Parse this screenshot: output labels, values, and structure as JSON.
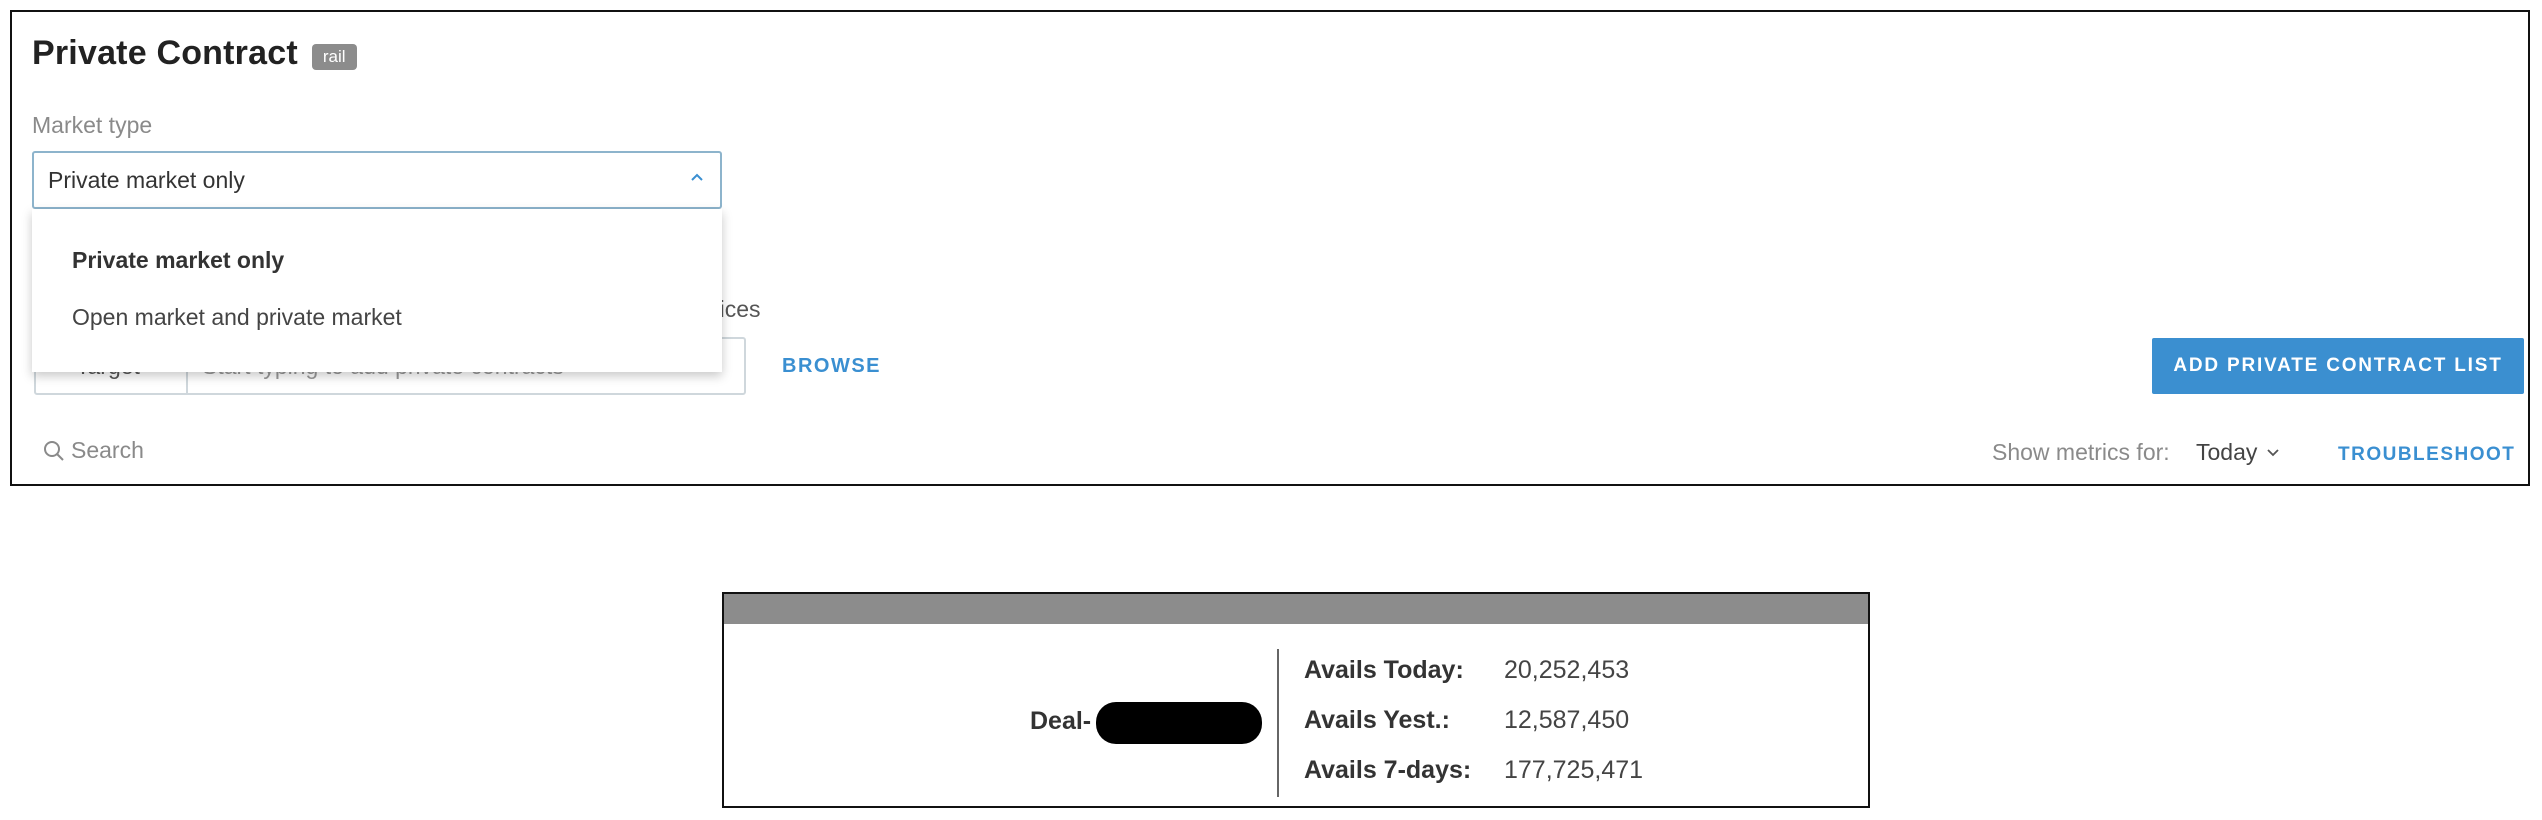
{
  "header": {
    "title": "Private Contract",
    "badge": "rail"
  },
  "market_type": {
    "label": "Market type",
    "selected": "Private market only",
    "options": [
      "Private market only",
      "Open market and private market"
    ]
  },
  "partial_label": "rices",
  "targeting": {
    "mode": "Target",
    "placeholder": "Start typing to add private contracts"
  },
  "actions": {
    "browse": "BROWSE",
    "add_list": "ADD PRIVATE CONTRACT LIST",
    "troubleshoot": "TROUBLESHOOT"
  },
  "search": {
    "label": "Search"
  },
  "metrics": {
    "label": "Show metrics for:",
    "value": "Today"
  },
  "deal_card": {
    "deal_label": "Deal-",
    "stats": [
      {
        "label": "Avails Today:",
        "value": "20,252,453"
      },
      {
        "label": "Avails Yest.:",
        "value": "12,587,450"
      },
      {
        "label": "Avails 7-days:",
        "value": "177,725,471"
      }
    ]
  },
  "colors": {
    "accent": "#3b8fd0",
    "badge": "#8c8c8c",
    "select_border": "#8db4cc"
  },
  "icons": [
    "chevron-up-icon",
    "chevron-down-icon",
    "search-icon"
  ]
}
